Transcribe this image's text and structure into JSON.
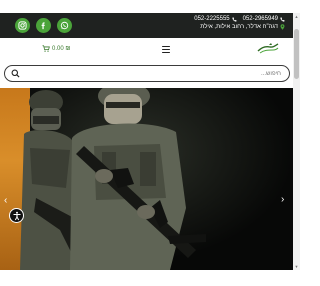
{
  "topbar": {
    "phones": [
      {
        "number": "052-2965949"
      },
      {
        "number": "052-2225555"
      }
    ],
    "address": "דגה\"ח אדלר, רחוב אילות, אילת",
    "social": [
      {
        "name": "whatsapp-icon"
      },
      {
        "name": "facebook-icon"
      },
      {
        "name": "instagram-icon"
      }
    ]
  },
  "header": {
    "cart_amount": "0.00 ₪",
    "cart_icon": "cart-icon",
    "menu_icon": "hamburger-menu-icon",
    "logo_icon": "logo-icon"
  },
  "search": {
    "placeholder": "חיפוש...",
    "icon": "search-icon"
  },
  "hero": {
    "prev_arrow": "‹",
    "next_arrow": "›"
  },
  "colors": {
    "topbar_bg": "#1f2220",
    "social_green": "#4ba43a",
    "cart_green": "#3a7a2e"
  }
}
